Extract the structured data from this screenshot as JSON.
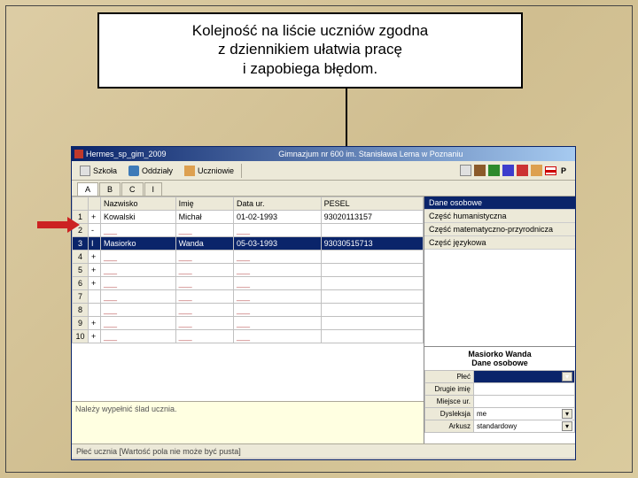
{
  "callout": {
    "line1": "Kolejność na liście uczniów zgodna",
    "line2": "z dziennikiem ułatwia pracę",
    "line3": "i zapobiega błędom."
  },
  "app": {
    "title_app": "Hermes_sp_gim_2009",
    "title_school": "Gimnazjum nr 600 im. Stanisława Lema w Poznaniu",
    "toolbar": {
      "schools": "Szkoła",
      "classes": "Oddziały",
      "students": "Uczniowie",
      "flag": "P"
    },
    "tabs": [
      "A",
      "B",
      "C",
      "I"
    ],
    "grid": {
      "headers": {
        "num": "",
        "surname": "Nazwisko",
        "name": "Imię",
        "dob": "Data ur.",
        "pesel": "PESEL"
      },
      "rows": [
        {
          "n": "1",
          "mark": "+",
          "surname": "Kowalski",
          "name": "Michał",
          "dob": "01-02-1993",
          "pesel": "93020113157"
        },
        {
          "n": "2",
          "mark": "-",
          "surname": "___",
          "name": "___",
          "dob": "___",
          "pesel": ""
        },
        {
          "n": "3",
          "mark": "I",
          "surname": "Masiorko",
          "name": "Wanda",
          "dob": "05-03-1993",
          "pesel": "93030515713",
          "selected": true
        },
        {
          "n": "4",
          "mark": "+",
          "surname": "___",
          "name": "___",
          "dob": "___",
          "pesel": ""
        },
        {
          "n": "5",
          "mark": "+",
          "surname": "___",
          "name": "___",
          "dob": "___",
          "pesel": ""
        },
        {
          "n": "6",
          "mark": "+",
          "surname": "___",
          "name": "___",
          "dob": "___",
          "pesel": ""
        },
        {
          "n": "7",
          "mark": "",
          "surname": "___",
          "name": "___",
          "dob": "___",
          "pesel": ""
        },
        {
          "n": "8",
          "mark": "",
          "surname": "___",
          "name": "___",
          "dob": "___",
          "pesel": ""
        },
        {
          "n": "9",
          "mark": "+",
          "surname": "___",
          "name": "___",
          "dob": "___",
          "pesel": ""
        },
        {
          "n": "10",
          "mark": "+",
          "surname": "___",
          "name": "___",
          "dob": "___",
          "pesel": ""
        }
      ]
    },
    "hint": "Należy wypełnić ślad ucznia.",
    "side_tabs": [
      "Dane osobowe",
      "Część humanistyczna",
      "Część matematyczno-przyrodnicza",
      "Część językowa"
    ],
    "detail": {
      "name": "Masiorko Wanda",
      "title": "Dane osobowe",
      "rows": [
        {
          "label": "Płeć",
          "value": "",
          "selected": true,
          "dropdown": true
        },
        {
          "label": "Drugie imię",
          "value": ""
        },
        {
          "label": "Miejsce ur.",
          "value": ""
        },
        {
          "label": "Dysleksja",
          "value": "me",
          "dropdown": true
        },
        {
          "label": "Arkusz",
          "value": "standardowy",
          "dropdown": true
        }
      ]
    },
    "status": "Płeć ucznia [Wartość pola nie może być pusta]"
  }
}
